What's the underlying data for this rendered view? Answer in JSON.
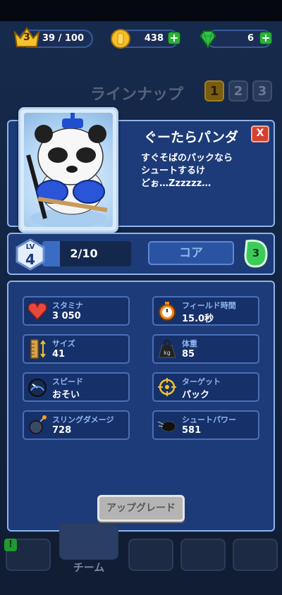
{
  "resources": {
    "player_level": "3",
    "xp": "39 / 100",
    "coins": "438",
    "gems": "6"
  },
  "lineup": {
    "title": "ラインナップ",
    "tabs": [
      "1",
      "2",
      "3"
    ]
  },
  "character": {
    "name": "ぐーたらパンダ",
    "description": "すぐそばのパックなら\nシュートするけ\nどぉ…Zzzzzz…",
    "close_label": "X"
  },
  "level": {
    "lv_label": "LV",
    "lv": "4",
    "cards": "2/10",
    "progress": 0.2,
    "core_label": "コア",
    "core_count": "3"
  },
  "stats": [
    {
      "label": "スタミナ",
      "value": "3 050",
      "icon": "heart-icon"
    },
    {
      "label": "フィールド時間",
      "value": "15.0秒",
      "icon": "stopwatch-icon"
    },
    {
      "label": "サイズ",
      "value": "41",
      "icon": "ruler-icon"
    },
    {
      "label": "体重",
      "value": "85",
      "icon": "weight-icon"
    },
    {
      "label": "スピード",
      "value": "おそい",
      "icon": "speedometer-icon"
    },
    {
      "label": "ターゲット",
      "value": "パック",
      "icon": "crosshair-icon"
    },
    {
      "label": "スリングダメージ",
      "value": "728",
      "icon": "bomb-icon"
    },
    {
      "label": "シュートパワー",
      "value": "581",
      "icon": "puck-icon"
    }
  ],
  "upgrade_label": "アップグレード",
  "nav": {
    "team_label": "チーム",
    "alert": "!"
  }
}
